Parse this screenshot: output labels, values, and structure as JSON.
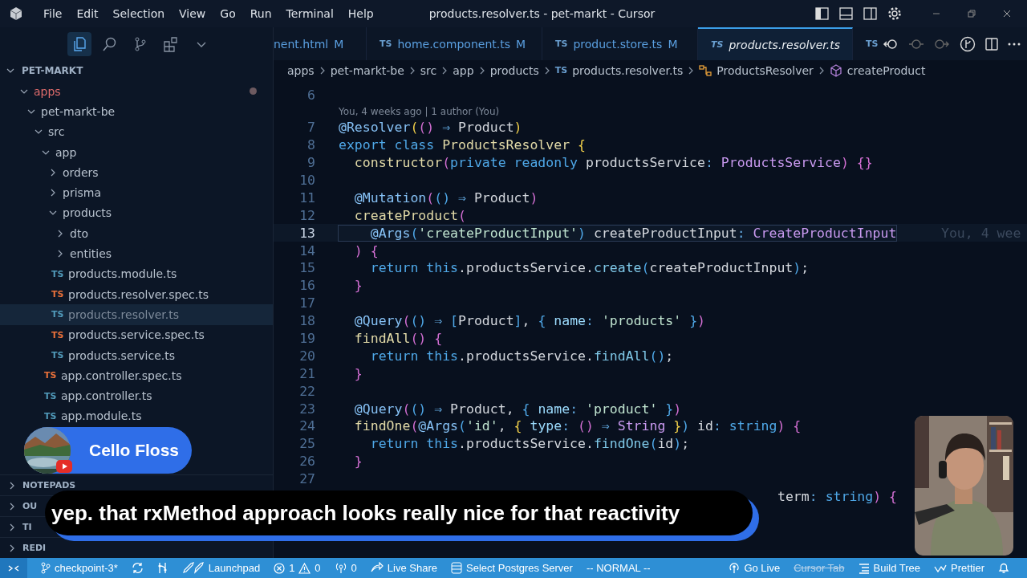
{
  "window": {
    "title": "products.resolver.ts - pet-markt - Cursor"
  },
  "menu": [
    "File",
    "Edit",
    "Selection",
    "View",
    "Go",
    "Run",
    "Terminal",
    "Help"
  ],
  "activity_bar": [
    {
      "kind": "files",
      "selected": true
    },
    {
      "kind": "search",
      "selected": false
    },
    {
      "kind": "source-control",
      "selected": false
    },
    {
      "kind": "extensions",
      "selected": false
    },
    {
      "kind": "more",
      "selected": false
    }
  ],
  "explorer": {
    "title": "PET-MARKT",
    "expanded": true,
    "tree": [
      {
        "label": "apps",
        "kind": "folder",
        "expanded": true,
        "modified": true,
        "selected": false,
        "children": [
          {
            "label": "pet-markt-be",
            "kind": "folder",
            "expanded": true,
            "modified": false,
            "selected": false,
            "children": [
              {
                "label": "src",
                "kind": "folder",
                "expanded": true,
                "modified": false,
                "selected": false,
                "children": [
                  {
                    "label": "app",
                    "kind": "folder",
                    "expanded": true,
                    "modified": false,
                    "selected": false,
                    "children": [
                      {
                        "label": "orders",
                        "kind": "folder",
                        "expanded": false,
                        "modified": false,
                        "selected": false
                      },
                      {
                        "label": "prisma",
                        "kind": "folder",
                        "expanded": false,
                        "modified": false,
                        "selected": false
                      },
                      {
                        "label": "products",
                        "kind": "folder",
                        "expanded": true,
                        "modified": false,
                        "selected": false,
                        "children": [
                          {
                            "label": "dto",
                            "kind": "folder",
                            "expanded": false,
                            "modified": false,
                            "selected": false
                          },
                          {
                            "label": "entities",
                            "kind": "folder",
                            "expanded": false,
                            "modified": false,
                            "selected": false
                          },
                          {
                            "label": "products.module.ts",
                            "kind": "file",
                            "icon": "TS",
                            "color": "#519aba",
                            "modified": false,
                            "selected": false
                          },
                          {
                            "label": "products.resolver.spec.ts",
                            "kind": "file",
                            "icon": "TS",
                            "color": "#e8703a",
                            "modified": false,
                            "selected": false
                          },
                          {
                            "label": "products.resolver.ts",
                            "kind": "file",
                            "icon": "TS",
                            "color": "#519aba",
                            "modified": false,
                            "selected": true
                          },
                          {
                            "label": "products.service.spec.ts",
                            "kind": "file",
                            "icon": "TS",
                            "color": "#e8703a",
                            "modified": false,
                            "selected": false
                          },
                          {
                            "label": "products.service.ts",
                            "kind": "file",
                            "icon": "TS",
                            "color": "#519aba",
                            "modified": false,
                            "selected": false
                          }
                        ]
                      },
                      {
                        "label": "app.controller.spec.ts",
                        "kind": "file",
                        "icon": "TS",
                        "color": "#e8703a",
                        "modified": false,
                        "selected": false
                      },
                      {
                        "label": "app.controller.ts",
                        "kind": "file",
                        "icon": "TS",
                        "color": "#519aba",
                        "modified": false,
                        "selected": false
                      },
                      {
                        "label": "app.module.ts",
                        "kind": "file",
                        "icon": "TS",
                        "color": "#519aba",
                        "modified": false,
                        "selected": false
                      }
                    ]
                  }
                ]
              }
            ]
          }
        ]
      }
    ]
  },
  "sections": [
    {
      "label": "NOTEPADS",
      "expanded": false
    },
    {
      "label": "OU",
      "expanded": false
    },
    {
      "label": "TI",
      "expanded": false
    },
    {
      "label": "REDI",
      "expanded": false
    }
  ],
  "tabs": [
    {
      "label": "nent.html",
      "status": "M",
      "selected": false
    },
    {
      "icon": "TS",
      "label": "home.component.ts",
      "status": "M",
      "selected": false
    },
    {
      "icon": "TS",
      "label": "product.store.ts",
      "status": "M",
      "selected": false
    },
    {
      "icon": "TS",
      "label": "products.resolver.ts",
      "selected": true
    },
    {
      "icon": "TS",
      "selected": false
    }
  ],
  "editor_actions": [
    {
      "kind": "back"
    },
    {
      "kind": "step"
    },
    {
      "kind": "forward"
    },
    {
      "kind": "git"
    },
    {
      "kind": "split"
    },
    {
      "kind": "more"
    }
  ],
  "breadcrumbs": [
    {
      "kind": "folder",
      "label": "apps"
    },
    {
      "kind": "folder",
      "label": "pet-markt-be"
    },
    {
      "kind": "folder",
      "label": "src"
    },
    {
      "kind": "folder",
      "label": "app"
    },
    {
      "kind": "folder",
      "label": "products"
    },
    {
      "kind": "file",
      "icon": "TS",
      "label": "products.resolver.ts"
    },
    {
      "kind": "class",
      "label": "ProductsResolver"
    },
    {
      "kind": "method",
      "label": "createProduct"
    }
  ],
  "editor": {
    "lines": [
      {
        "number": "6",
        "current": false
      },
      {
        "number": "7",
        "current": false,
        "codelens": "You, 4 weeks ago | 1 author (You)",
        "tokens": [
          {
            "kind": "dec",
            "text": "@Resolver"
          },
          {
            "kind": "br1",
            "text": "("
          },
          {
            "kind": "br2",
            "text": "()"
          },
          {
            "kind": "op",
            "text": " ⇒ "
          },
          {
            "kind": "plain",
            "text": "Product"
          },
          {
            "kind": "br1",
            "text": ")"
          }
        ]
      },
      {
        "number": "8",
        "current": false,
        "tokens": [
          {
            "kind": "kw",
            "text": "export class "
          },
          {
            "kind": "cls",
            "text": "ProductsResolver "
          },
          {
            "kind": "br1",
            "text": "{"
          }
        ]
      },
      {
        "number": "9",
        "current": false,
        "tokens": [
          {
            "kind": "fn",
            "text": "  constructor"
          },
          {
            "kind": "br2",
            "text": "("
          },
          {
            "kind": "kw",
            "text": "private readonly "
          },
          {
            "kind": "plain",
            "text": "productsService"
          },
          {
            "kind": "op",
            "text": ": "
          },
          {
            "kind": "type",
            "text": "ProductsService"
          },
          {
            "kind": "br2",
            "text": ") {}"
          }
        ]
      },
      {
        "number": "10",
        "current": false
      },
      {
        "number": "11",
        "current": false,
        "tokens": [
          {
            "kind": "dec",
            "text": "  @Mutation"
          },
          {
            "kind": "br2",
            "text": "("
          },
          {
            "kind": "br3",
            "text": "()"
          },
          {
            "kind": "op",
            "text": " ⇒ "
          },
          {
            "kind": "plain",
            "text": "Product"
          },
          {
            "kind": "br2",
            "text": ")"
          }
        ]
      },
      {
        "number": "12",
        "current": false,
        "tokens": [
          {
            "kind": "fn",
            "text": "  createProduct"
          },
          {
            "kind": "br2",
            "text": "("
          }
        ]
      },
      {
        "number": "13",
        "current": true,
        "blame": "You, 4 wee",
        "tokens": [
          {
            "kind": "dec",
            "text": "    @Args"
          },
          {
            "kind": "br3",
            "text": "("
          },
          {
            "kind": "str",
            "text": "'createProductInput'"
          },
          {
            "kind": "br3",
            "text": ")"
          },
          {
            "kind": "plain",
            "text": " createProductInput"
          },
          {
            "kind": "op",
            "text": ": "
          },
          {
            "kind": "type",
            "text": "CreateProductInput"
          }
        ]
      },
      {
        "number": "14",
        "current": false,
        "tokens": [
          {
            "kind": "br2",
            "text": "  ) {"
          }
        ]
      },
      {
        "number": "15",
        "current": false,
        "tokens": [
          {
            "kind": "kw",
            "text": "    return this"
          },
          {
            "kind": "plain",
            "text": ".productsService."
          },
          {
            "kind": "fn2",
            "text": "create"
          },
          {
            "kind": "br3",
            "text": "("
          },
          {
            "kind": "plain",
            "text": "createProductInput"
          },
          {
            "kind": "br3",
            "text": ")"
          },
          {
            "kind": "plain",
            "text": ";"
          }
        ]
      },
      {
        "number": "16",
        "current": false,
        "tokens": [
          {
            "kind": "br2",
            "text": "  }"
          }
        ]
      },
      {
        "number": "17",
        "current": false
      },
      {
        "number": "18",
        "current": false,
        "tokens": [
          {
            "kind": "dec",
            "text": "  @Query"
          },
          {
            "kind": "br2",
            "text": "("
          },
          {
            "kind": "br3",
            "text": "()"
          },
          {
            "kind": "op",
            "text": " ⇒ "
          },
          {
            "kind": "br3",
            "text": "["
          },
          {
            "kind": "plain",
            "text": "Product"
          },
          {
            "kind": "br3",
            "text": "]"
          },
          {
            "kind": "plain",
            "text": ", "
          },
          {
            "kind": "br3",
            "text": "{"
          },
          {
            "kind": "prop",
            "text": " name"
          },
          {
            "kind": "op",
            "text": ": "
          },
          {
            "kind": "str",
            "text": "'products'"
          },
          {
            "kind": "br3",
            "text": " }"
          },
          {
            "kind": "br2",
            "text": ")"
          }
        ]
      },
      {
        "number": "19",
        "current": false,
        "tokens": [
          {
            "kind": "fn",
            "text": "  findAll"
          },
          {
            "kind": "br2",
            "text": "() {"
          }
        ]
      },
      {
        "number": "20",
        "current": false,
        "tokens": [
          {
            "kind": "kw",
            "text": "    return this"
          },
          {
            "kind": "plain",
            "text": ".productsService."
          },
          {
            "kind": "fn2",
            "text": "findAll"
          },
          {
            "kind": "br3",
            "text": "()"
          },
          {
            "kind": "plain",
            "text": ";"
          }
        ]
      },
      {
        "number": "21",
        "current": false,
        "tokens": [
          {
            "kind": "br2",
            "text": "  }"
          }
        ]
      },
      {
        "number": "22",
        "current": false
      },
      {
        "number": "23",
        "current": false,
        "tokens": [
          {
            "kind": "dec",
            "text": "  @Query"
          },
          {
            "kind": "br2",
            "text": "("
          },
          {
            "kind": "br3",
            "text": "()"
          },
          {
            "kind": "op",
            "text": " ⇒ "
          },
          {
            "kind": "plain",
            "text": "Product, "
          },
          {
            "kind": "br3",
            "text": "{"
          },
          {
            "kind": "prop",
            "text": " name"
          },
          {
            "kind": "op",
            "text": ": "
          },
          {
            "kind": "str",
            "text": "'product'"
          },
          {
            "kind": "br3",
            "text": " }"
          },
          {
            "kind": "br2",
            "text": ")"
          }
        ]
      },
      {
        "number": "24",
        "current": false,
        "tokens": [
          {
            "kind": "fn",
            "text": "  findOne"
          },
          {
            "kind": "br2",
            "text": "("
          },
          {
            "kind": "dec",
            "text": "@Args"
          },
          {
            "kind": "br3",
            "text": "("
          },
          {
            "kind": "str",
            "text": "'id'"
          },
          {
            "kind": "plain",
            "text": ", "
          },
          {
            "kind": "br1",
            "text": "{"
          },
          {
            "kind": "prop",
            "text": " type"
          },
          {
            "kind": "op",
            "text": ": "
          },
          {
            "kind": "br2",
            "text": "()"
          },
          {
            "kind": "op",
            "text": " ⇒ "
          },
          {
            "kind": "type",
            "text": "String"
          },
          {
            "kind": "br1",
            "text": " }"
          },
          {
            "kind": "br3",
            "text": ")"
          },
          {
            "kind": "plain",
            "text": " id"
          },
          {
            "kind": "op",
            "text": ": "
          },
          {
            "kind": "kw",
            "text": "string"
          },
          {
            "kind": "br2",
            "text": ") {"
          }
        ]
      },
      {
        "number": "25",
        "current": false,
        "tokens": [
          {
            "kind": "kw",
            "text": "    return this"
          },
          {
            "kind": "plain",
            "text": ".productsService."
          },
          {
            "kind": "fn2",
            "text": "findOne"
          },
          {
            "kind": "br3",
            "text": "("
          },
          {
            "kind": "plain",
            "text": "id"
          },
          {
            "kind": "br3",
            "text": ")"
          },
          {
            "kind": "plain",
            "text": ";"
          }
        ]
      },
      {
        "number": "26",
        "current": false,
        "tokens": [
          {
            "kind": "br2",
            "text": "  }"
          }
        ]
      },
      {
        "number": "27",
        "current": false
      }
    ],
    "partial_line": [
      {
        "kind": "plain",
        "text": "term"
      },
      {
        "kind": "op",
        "text": ": "
      },
      {
        "kind": "kw",
        "text": "string"
      },
      {
        "kind": "br2",
        "text": ") {"
      }
    ]
  },
  "overlay": {
    "channel": "Cello Floss",
    "caption": "yep. that rxMethod approach looks really nice for that reactivity"
  },
  "status_bar": {
    "left": [
      {
        "kind": "remote"
      },
      {
        "kind": "branch",
        "text": "checkpoint-3*"
      },
      {
        "kind": "sync"
      },
      {
        "kind": "graph"
      },
      {
        "kind": "launchpad",
        "text": "Launchpad"
      },
      {
        "kind": "problems",
        "errors": "1",
        "warnings": "0"
      },
      {
        "kind": "ports",
        "text": "0"
      },
      {
        "kind": "liveshare",
        "text": "Live Share"
      },
      {
        "kind": "database",
        "text": "Select Postgres Server"
      },
      {
        "kind": "plain",
        "text": "-- NORMAL --"
      }
    ],
    "right": [
      {
        "kind": "golive",
        "text": "Go Live",
        "disabled": false
      },
      {
        "kind": "plain",
        "text": "Cursor Tab",
        "disabled": true
      },
      {
        "kind": "tree",
        "text": "Build Tree",
        "disabled": false
      },
      {
        "kind": "prettier",
        "text": "Prettier",
        "disabled": false
      },
      {
        "kind": "bell"
      }
    ]
  }
}
